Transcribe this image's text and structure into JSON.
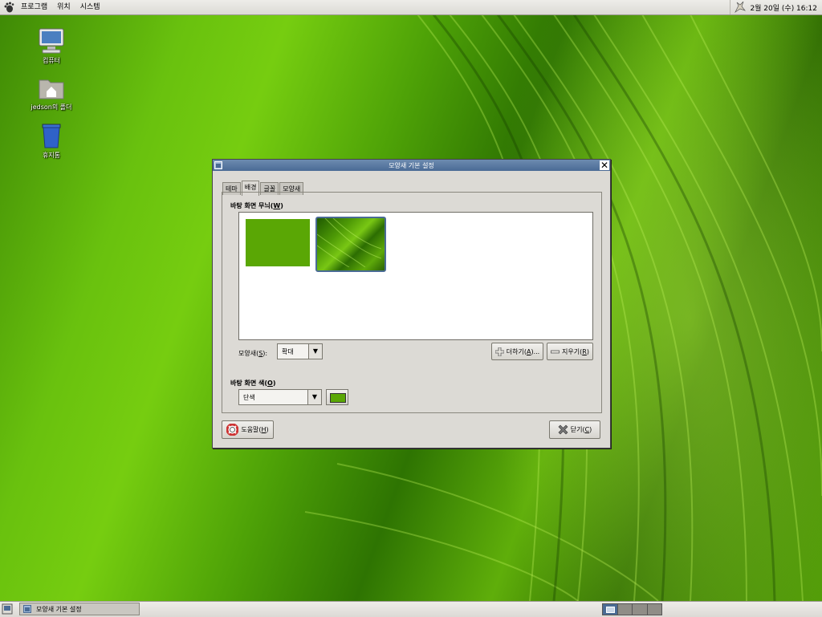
{
  "top_panel": {
    "menus": [
      "프로그램",
      "위치",
      "시스템"
    ],
    "clock": "2월 20일 (수) 16:12"
  },
  "desktop": {
    "icons": [
      {
        "label": "컴퓨터",
        "icon": "computer-icon"
      },
      {
        "label": "jedson의 폴더",
        "icon": "home-folder-icon"
      },
      {
        "label": "휴지통",
        "icon": "trash-icon"
      }
    ]
  },
  "dialog": {
    "title": "모양새 기본 설정",
    "tabs": [
      "테마",
      "배경",
      "글꼴",
      "모양새"
    ],
    "active_tab": "배경",
    "wallpaper_section": {
      "label": "바탕 화면 무늬",
      "mnemonic": "W"
    },
    "style": {
      "label": "모양새(",
      "mnemonic": "S",
      "suffix": "):",
      "value": "확대"
    },
    "add_button": {
      "label": "더하기(",
      "mnemonic": "A",
      "suffix": ")..."
    },
    "remove_button": {
      "label": "지우기(",
      "mnemonic": "R",
      "suffix": ")"
    },
    "color_section": {
      "label": "바탕 화면 색",
      "mnemonic": "O"
    },
    "color_mode": "단색",
    "selected_color": "#5aa705",
    "help_button": {
      "label": "도움말(",
      "mnemonic": "H",
      "suffix": ")"
    },
    "close_button": {
      "label": "닫기(",
      "mnemonic": "C",
      "suffix": ")"
    }
  },
  "bottom_panel": {
    "task": "모양새 기본 설정",
    "workspaces": 4,
    "active_workspace": 1
  }
}
